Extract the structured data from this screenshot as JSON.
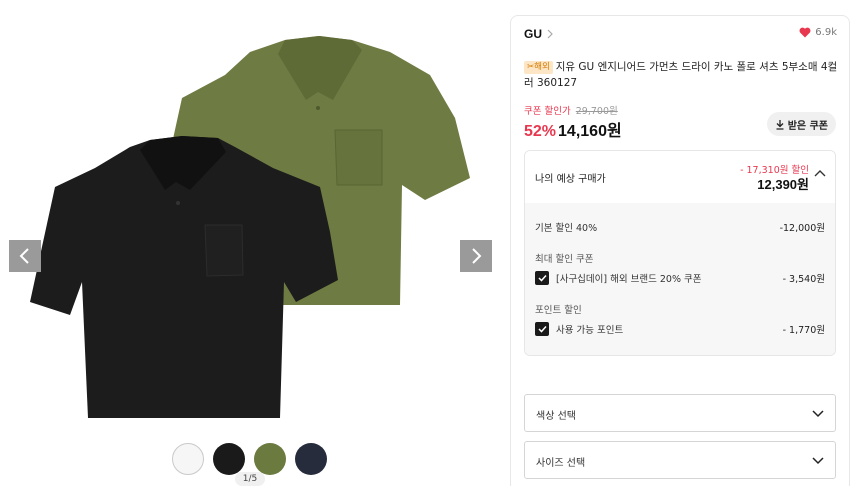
{
  "gallery": {
    "page_indicator": "1/5",
    "swatches": [
      "white",
      "black",
      "olive",
      "navy"
    ]
  },
  "product": {
    "brand": "GU",
    "likes": "6.9k",
    "tag": "✂해외",
    "title": "지유 GU 엔지니어드 가먼츠 드라이 카노 폴로 셔츠 5부소매 4컬러 360127",
    "coupon_label": "쿠폰 할인가",
    "original_price": "29,700원",
    "discount_rate": "52%",
    "sale_price": "14,160원",
    "coupon_button": "받은 쿠폰"
  },
  "estimate": {
    "label": "나의 예상 구매가",
    "saving": "- 17,310원 할인",
    "price": "12,390원",
    "base_discount_label": "기본 할인 40%",
    "base_discount_amount": "-12,000원",
    "coupon_section": "최대 할인 쿠폰",
    "coupon_item": "[사구십데이] 해외 브랜드 20% 쿠폰",
    "coupon_amount": "- 3,540원",
    "point_section": "포인트 할인",
    "point_item": "사용 가능 포인트",
    "point_amount": "- 1,770원"
  },
  "options": {
    "color_select": "색상 선택",
    "size_select": "사이즈 선택"
  },
  "colors": {
    "accent_red": "#e8384f",
    "olive": "#6b7a3f",
    "black": "#1a1a1a",
    "navy": "#262c3c"
  }
}
